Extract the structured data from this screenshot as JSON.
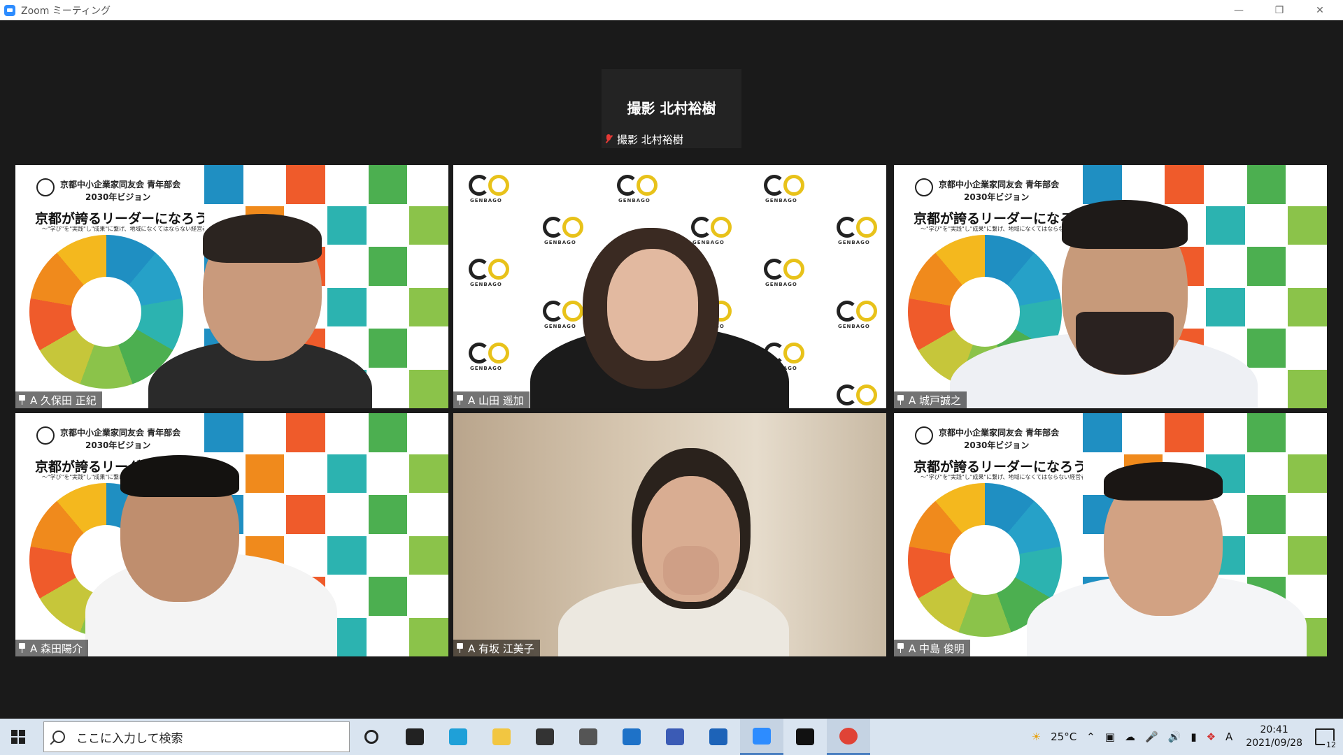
{
  "window": {
    "title": "Zoom ミーティング"
  },
  "active_speaker": {
    "name_large": "撮影 北村裕樹",
    "name_small": "撮影 北村裕樹"
  },
  "participants": [
    {
      "label": "A 久保田 正紀",
      "background": "vision-slide",
      "speaking": false
    },
    {
      "label": "A 山田 遥加",
      "background": "genbago",
      "speaking": true
    },
    {
      "label": "A  城戸誠之",
      "background": "vision-slide",
      "speaking": false
    },
    {
      "label": "A 森田陽介",
      "background": "vision-slide",
      "speaking": false
    },
    {
      "label": "A 有坂 江美子",
      "background": "room",
      "speaking": false
    },
    {
      "label": "A 中島 俊明",
      "background": "vision-slide",
      "speaking": false
    }
  ],
  "slide": {
    "org": "京都中小企業家同友会  青年部会",
    "vision": "2030年ビジョン",
    "catch": "京都が誇るリーダーになろう",
    "sub": "〜\"学び\"を\"実践\"し\"成果\"に繋げ、地域になくてはならない経営者へ〜"
  },
  "genbago": {
    "logo_text": "GENBAGO"
  },
  "taskbar": {
    "search_placeholder": "ここに入力して検索",
    "weather": "25°C",
    "ime": "A",
    "time": "20:41",
    "date": "2021/09/28",
    "notification_count": "12",
    "apps": [
      {
        "name": "cortana",
        "color": "#222222"
      },
      {
        "name": "task-view",
        "color": "#222222"
      },
      {
        "name": "edge",
        "color": "#1fa0d8"
      },
      {
        "name": "file-explorer",
        "color": "#f2c641"
      },
      {
        "name": "store",
        "color": "#333333"
      },
      {
        "name": "app-gray",
        "color": "#555555"
      },
      {
        "name": "mail",
        "color": "#1e72c8"
      },
      {
        "name": "app-blue",
        "color": "#3b5bb5"
      },
      {
        "name": "calendar",
        "color": "#1d63b8"
      },
      {
        "name": "zoom",
        "color": "#2d8cff"
      },
      {
        "name": "app-black",
        "color": "#111111"
      },
      {
        "name": "chrome",
        "color": "#e04336"
      }
    ]
  },
  "colors": {
    "speaking_border": "#d6e87a",
    "zoom_blue": "#2d8cff"
  }
}
